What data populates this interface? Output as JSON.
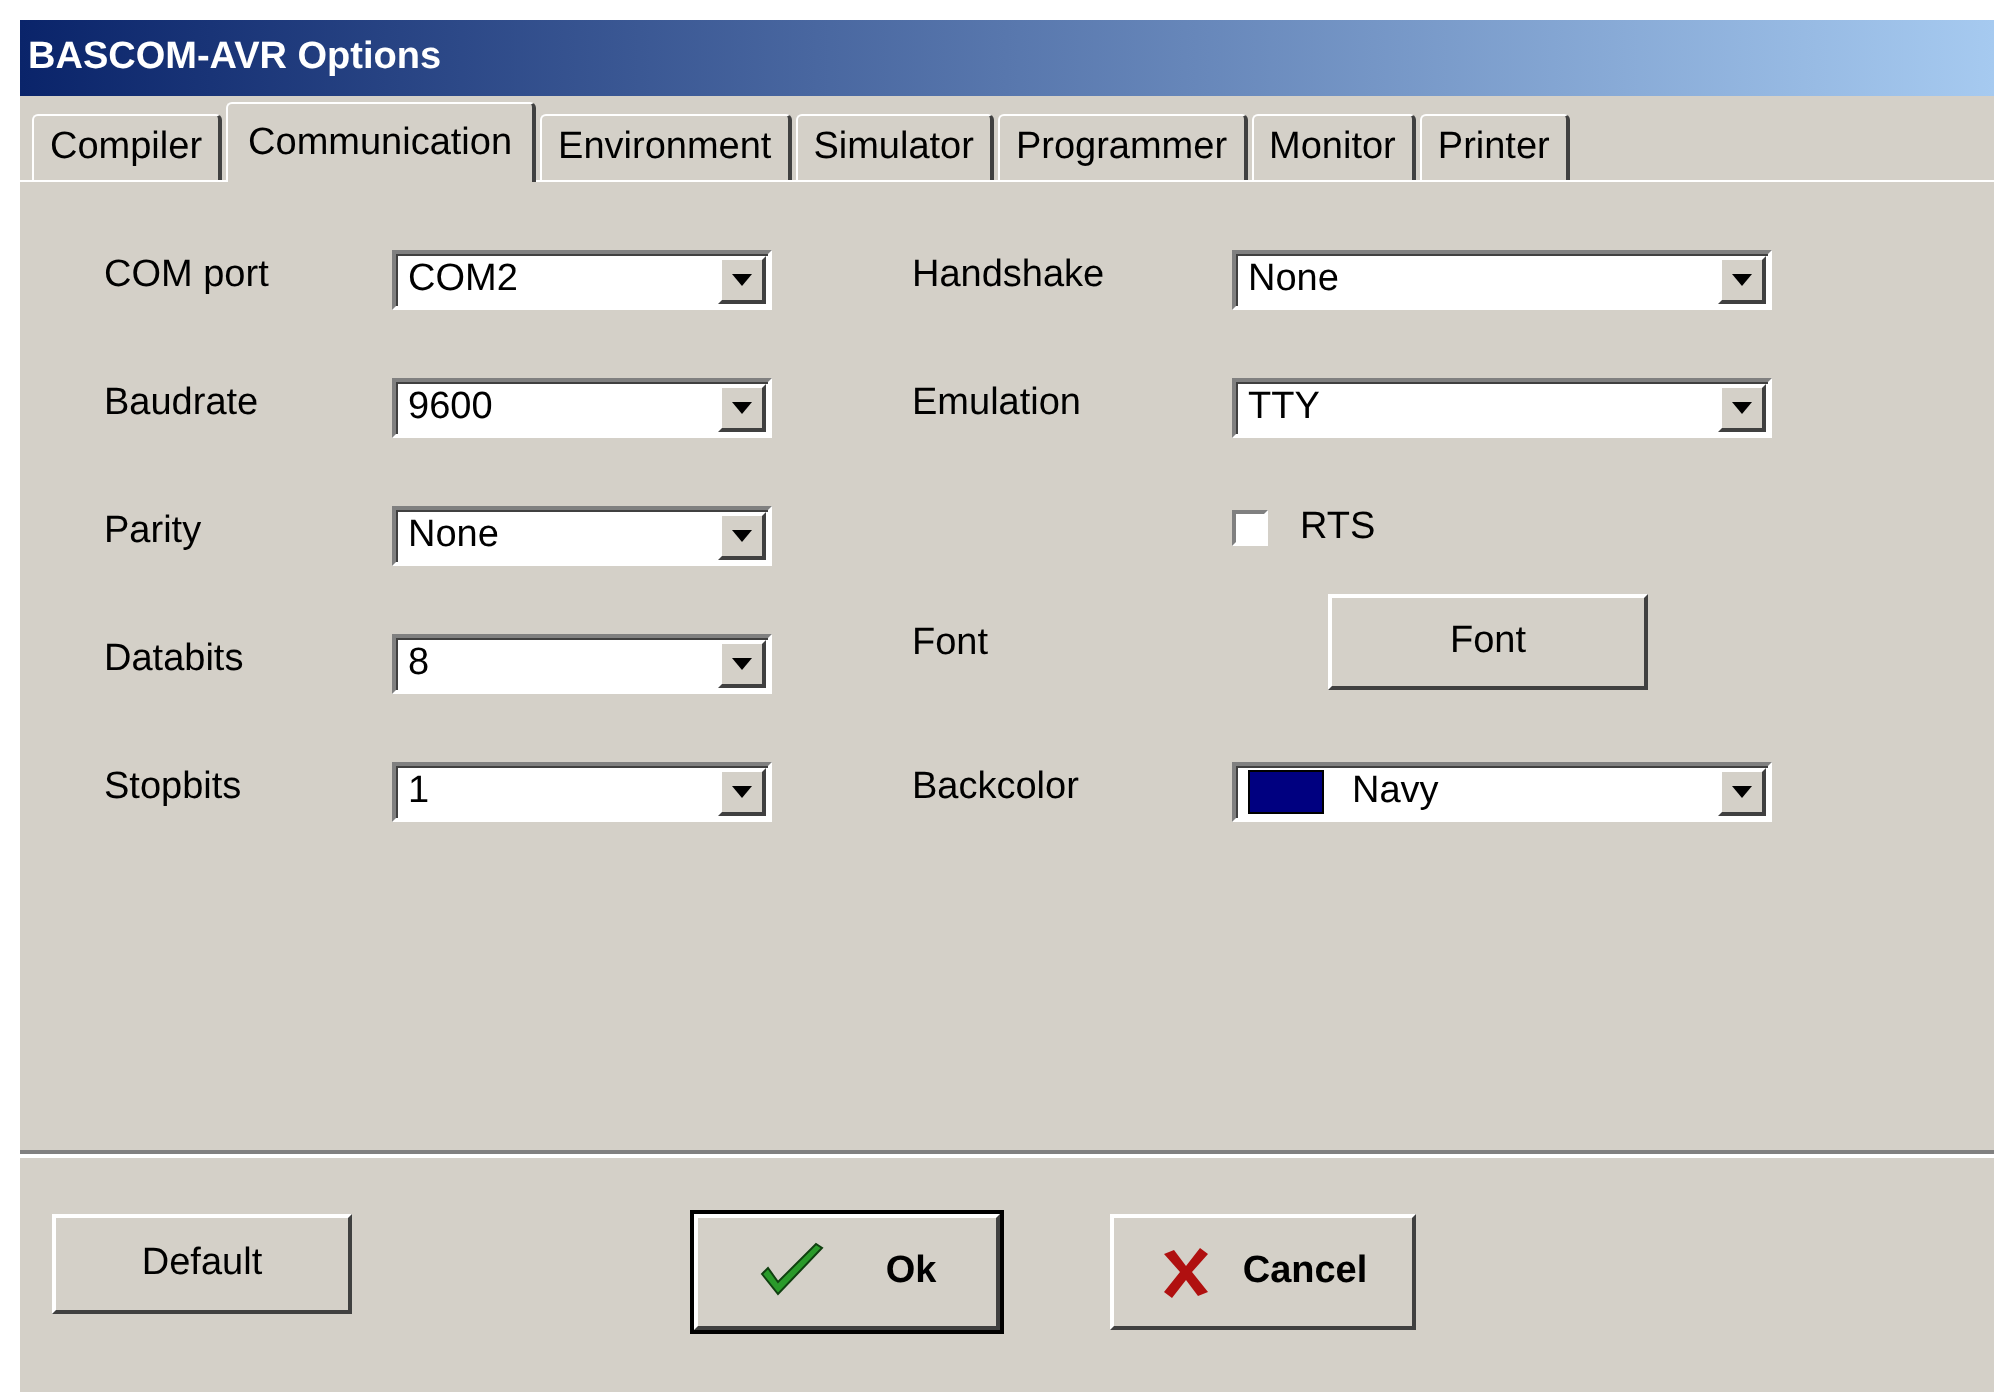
{
  "window": {
    "title": "BASCOM-AVR Options"
  },
  "tabs": [
    {
      "label": "Compiler",
      "selected": false
    },
    {
      "label": "Communication",
      "selected": true
    },
    {
      "label": "Environment",
      "selected": false
    },
    {
      "label": "Simulator",
      "selected": false
    },
    {
      "label": "Programmer",
      "selected": false
    },
    {
      "label": "Monitor",
      "selected": false
    },
    {
      "label": "Printer",
      "selected": false
    }
  ],
  "left_fields": [
    {
      "label": "COM port",
      "value": "COM2"
    },
    {
      "label": "Baudrate",
      "value": "9600"
    },
    {
      "label": "Parity",
      "value": "None"
    },
    {
      "label": "Databits",
      "value": "8"
    },
    {
      "label": "Stopbits",
      "value": "1"
    }
  ],
  "right_fields": [
    {
      "kind": "combo",
      "label": "Handshake",
      "value": "None"
    },
    {
      "kind": "combo",
      "label": "Emulation",
      "value": "TTY"
    },
    {
      "kind": "checkbox",
      "label": "RTS",
      "checked": false
    },
    {
      "kind": "button",
      "label": "Font",
      "button": "Font"
    },
    {
      "kind": "color",
      "label": "Backcolor",
      "value": "Navy",
      "color": "#000080"
    }
  ],
  "buttons": [
    {
      "kind": "plain",
      "label": "Default",
      "default": false
    },
    {
      "kind": "ok",
      "label": "Ok",
      "default": true
    },
    {
      "kind": "cancel",
      "label": "Cancel",
      "default": false
    }
  ]
}
